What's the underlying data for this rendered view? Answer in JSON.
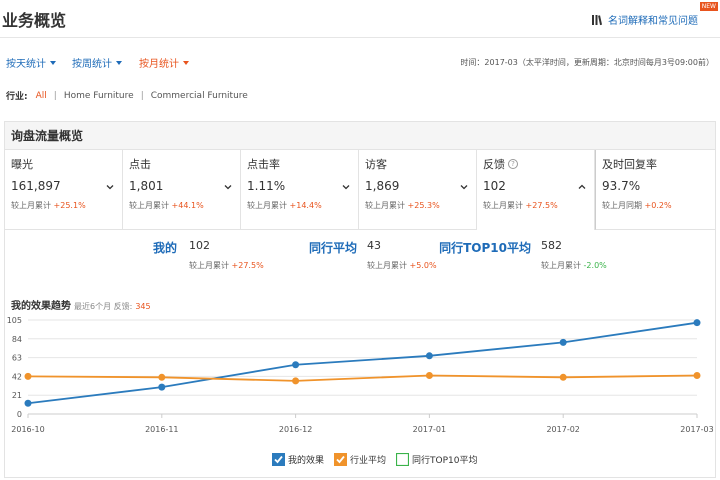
{
  "header": {
    "title": "业务概览",
    "help_link": "名词解释和常见问题",
    "new_badge": "NEW"
  },
  "period_tabs": [
    {
      "label": "按天统计",
      "active": false
    },
    {
      "label": "按周统计",
      "active": false
    },
    {
      "label": "按月统计",
      "active": true
    }
  ],
  "time_info": "时间：2017-03（太平洋时间，更新周期：北京时间每月3号09:00前）",
  "industry": {
    "label": "行业:",
    "options": [
      "All",
      "Home Furniture",
      "Commercial Furniture"
    ],
    "active_index": 0
  },
  "flow_panel": {
    "title": "询盘流量概览",
    "metrics": [
      {
        "label": "曝光",
        "value": "161,897",
        "compare_prefix": "较上月累计",
        "compare_change": "+25.1%",
        "chevron": "down",
        "help": false
      },
      {
        "label": "点击",
        "value": "1,801",
        "compare_prefix": "较上月累计",
        "compare_change": "+44.1%",
        "chevron": "down",
        "help": false
      },
      {
        "label": "点击率",
        "value": "1.11%",
        "compare_prefix": "较上月累计",
        "compare_change": "+14.4%",
        "chevron": "down",
        "help": false
      },
      {
        "label": "访客",
        "value": "1,869",
        "compare_prefix": "较上月累计",
        "compare_change": "+25.3%",
        "chevron": "down",
        "help": false
      },
      {
        "label": "反馈",
        "value": "102",
        "compare_prefix": "较上月累计",
        "compare_change": "+27.5%",
        "chevron": "up",
        "help": true
      },
      {
        "label": "及时回复率",
        "value": "93.7%",
        "compare_prefix": "较上月同期",
        "compare_change": "+0.2%",
        "chevron": "none",
        "help": false
      }
    ],
    "comparison": [
      {
        "label": "我的",
        "value": "102",
        "sub_prefix": "较上月累计",
        "sub_change": "+27.5%",
        "trend": "up"
      },
      {
        "label": "同行平均",
        "value": "43",
        "sub_prefix": "较上月累计",
        "sub_change": "+5.0%",
        "trend": "up"
      },
      {
        "label": "同行TOP10平均",
        "value": "582",
        "sub_prefix": "较上月累计",
        "sub_change": "-2.0%",
        "trend": "down"
      }
    ],
    "trend": {
      "title": "我的效果趋势",
      "subtitle": "最近6个月 反馈:",
      "count": "345"
    }
  },
  "colors": {
    "accent_blue": "#1e6bb8",
    "accent_orange": "#e8541e",
    "my_series": "#2b7bbd",
    "industry_series": "#f0932b",
    "top10_series": "#3bb34a"
  },
  "chart_data": {
    "type": "line",
    "x": [
      "2016-10",
      "2016-11",
      "2016-12",
      "2017-01",
      "2017-02",
      "2017-03"
    ],
    "ylim": [
      0,
      105
    ],
    "yticks": [
      0,
      21,
      42,
      63,
      84,
      105
    ],
    "grid": true,
    "legend_position": "bottom-center",
    "series": [
      {
        "name": "我的效果",
        "values": [
          12,
          30,
          55,
          65,
          80,
          102
        ],
        "visible": true
      },
      {
        "name": "行业平均",
        "values": [
          42,
          41,
          37,
          43,
          41,
          43
        ],
        "visible": true
      },
      {
        "name": "同行TOP10平均",
        "values": [],
        "visible": false
      }
    ]
  }
}
